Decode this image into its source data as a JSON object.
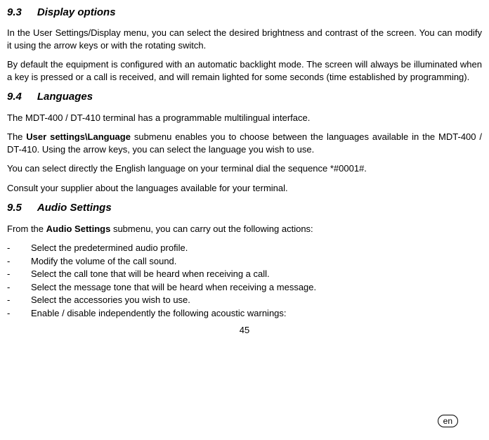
{
  "sections": {
    "s93": {
      "number": "9.3",
      "title": "Display options",
      "p1": "In the User Settings/Display menu, you can select the desired brightness and contrast of the screen. You can modify it using the arrow keys or with the rotating switch.",
      "p2": "By default the equipment is configured with an automatic backlight mode. The screen will always be illuminated when a key is pressed or a call is received, and will remain lighted for some seconds (time established by programming)."
    },
    "s94": {
      "number": "9.4",
      "title": "Languages",
      "p1": "The MDT-400 / DT-410 terminal has a programmable multilingual interface.",
      "p2_pre": "The ",
      "p2_bold": "User settings\\Language",
      "p2_post": " submenu enables you to choose between the languages available in the MDT-400 / DT-410. Using the arrow keys, you can select the language you wish to use.",
      "p3": "You can select directly the English language on your terminal dial the sequence *#0001#.",
      "p4": "Consult your supplier about the languages available for your terminal."
    },
    "s95": {
      "number": "9.5",
      "title": "Audio Settings",
      "p1_pre": "From the ",
      "p1_bold": "Audio Settings",
      "p1_post": " submenu, you can carry out the following actions:",
      "items": [
        "Select the predetermined audio profile.",
        "Modify the volume of the call sound.",
        "Select the call tone that will be heard when receiving a call.",
        "Select the message tone that will be heard when receiving a message.",
        "Select the accessories you wish to use.",
        "Enable / disable independently the following acoustic warnings:"
      ]
    }
  },
  "page_number": "45",
  "lang_badge": "en"
}
